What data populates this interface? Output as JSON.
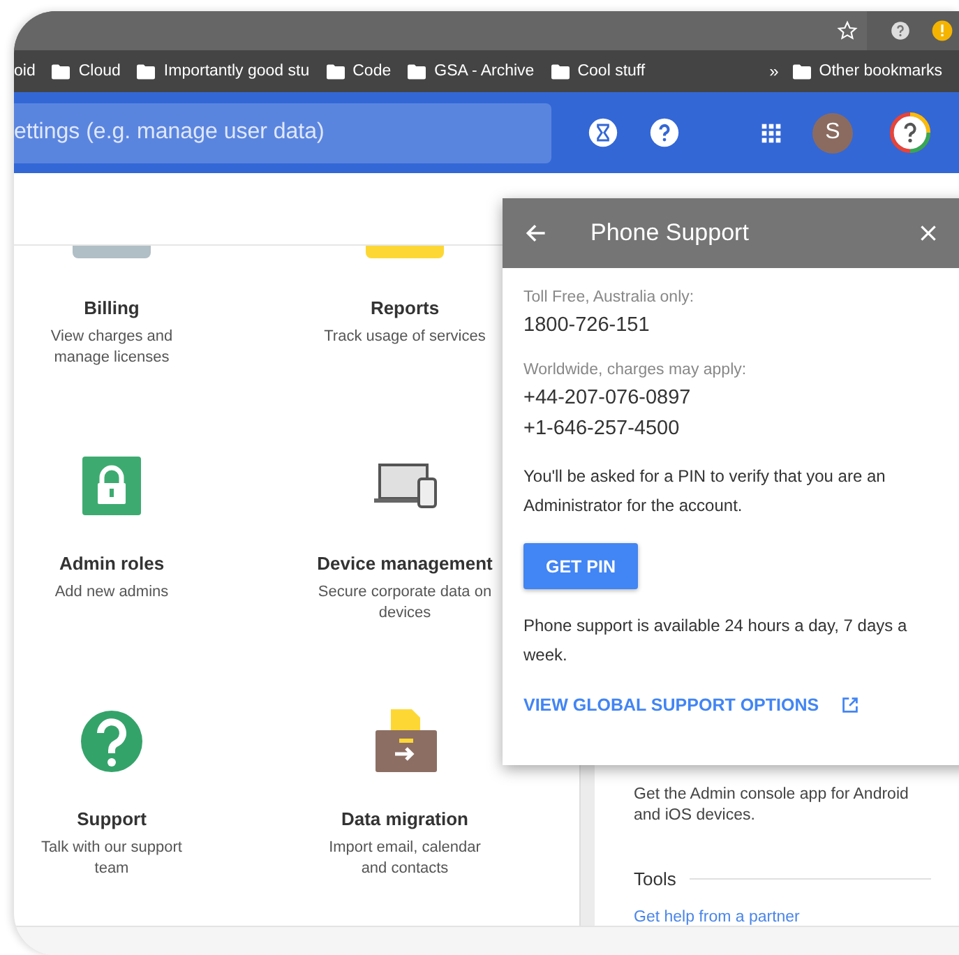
{
  "browser": {
    "bookmarks": [
      {
        "label": "oid",
        "kind": "cut"
      },
      {
        "label": "Cloud",
        "kind": "folder"
      },
      {
        "label": "Importantly good stu",
        "kind": "folder"
      },
      {
        "label": "Code",
        "kind": "folder"
      },
      {
        "label": "GSA - Archive",
        "kind": "folder"
      },
      {
        "label": "Cool stuff",
        "kind": "folder"
      }
    ],
    "overflow": "»",
    "other_bookmarks": "Other bookmarks"
  },
  "header": {
    "search": {
      "placeholder": "ettings (e.g. manage user data)"
    },
    "avatar": "S"
  },
  "tiles": [
    {
      "title": "Billing",
      "description": "View charges and manage licenses",
      "kind": "billing"
    },
    {
      "title": "Reports",
      "description": "Track usage of services",
      "kind": "reports"
    },
    {
      "title": "Admin roles",
      "description": "Add new admins",
      "kind": "lock"
    },
    {
      "title": "Device management",
      "description": "Secure corporate data on devices",
      "kind": "devices"
    },
    {
      "title": "Support",
      "description": "Talk with our support team",
      "kind": "help"
    },
    {
      "title": "Data migration",
      "description": "Import email, calendar and contacts",
      "kind": "migration"
    }
  ],
  "side_panel": {
    "text": "Get the Admin console app for Android and iOS devices.",
    "section": "Tools",
    "link": "Get help from a partner"
  },
  "popup": {
    "title": "Phone Support",
    "toll_free_label": "Toll Free, Australia only:",
    "toll_free_numbers": [
      "1800-726-151"
    ],
    "worldwide_label": "Worldwide, charges may apply:",
    "worldwide_numbers": [
      "+44-207-076-0897",
      "+1-646-257-4500"
    ],
    "pin_note": "You'll be asked for a PIN to verify that you are an Administrator for the account.",
    "button": "GET PIN",
    "availability": "Phone support is available 24 hours a day, 7 days a week.",
    "link": "VIEW GLOBAL SUPPORT OPTIONS"
  }
}
